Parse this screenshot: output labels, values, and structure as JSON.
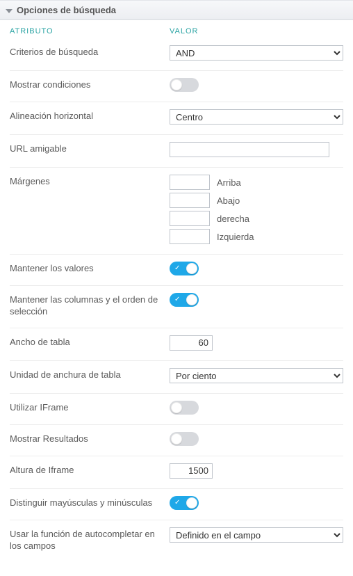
{
  "header": {
    "title": "Opciones de búsqueda"
  },
  "columns": {
    "attribute": "ATRIBUTO",
    "value": "VALOR"
  },
  "rows": {
    "criterios": {
      "label": "Criterios de búsqueda",
      "value": "AND"
    },
    "mostrar_cond": {
      "label": "Mostrar condiciones",
      "on": false
    },
    "alineacion": {
      "label": "Alineación horizontal",
      "value": "Centro"
    },
    "url": {
      "label": "URL amigable",
      "value": ""
    },
    "margenes": {
      "label": "Márgenes",
      "top": {
        "value": "",
        "label": "Arriba"
      },
      "bottom": {
        "value": "",
        "label": "Abajo"
      },
      "right": {
        "value": "",
        "label": "derecha"
      },
      "left": {
        "value": "",
        "label": "Izquierda"
      }
    },
    "mantener_val": {
      "label": "Mantener los valores",
      "on": true
    },
    "mantener_cols": {
      "label": "Mantener las columnas y el orden de selección",
      "on": true
    },
    "ancho": {
      "label": "Ancho de tabla",
      "value": "60"
    },
    "unidad": {
      "label": "Unidad de anchura de tabla",
      "value": "Por ciento"
    },
    "iframe_use": {
      "label": "Utilizar IFrame",
      "on": false
    },
    "resultados": {
      "label": "Mostrar Resultados",
      "on": false
    },
    "iframe_h": {
      "label": "Altura de Iframe",
      "value": "1500"
    },
    "caso": {
      "label": "Distinguir mayúsculas y minúsculas",
      "on": true
    },
    "autocomp": {
      "label": "Usar la función de autocompletar en los campos",
      "value": "Definido en el campo"
    }
  }
}
